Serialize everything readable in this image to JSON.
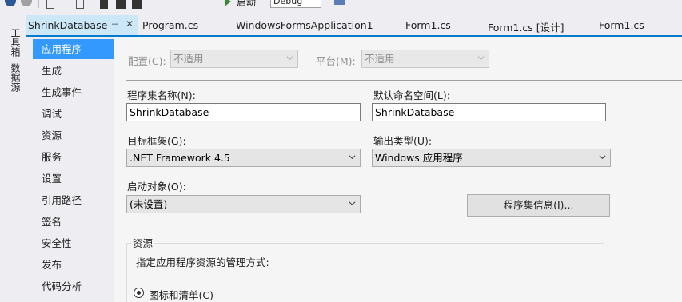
{
  "toolbar": {
    "start_label": "启动",
    "config_value": "Debug"
  },
  "side_tabs": [
    "工具箱",
    "数据源"
  ],
  "document_tabs": {
    "active": "ShrinkDatabase",
    "pin_icon": "pin-icon",
    "close_icon": "close-icon",
    "others": [
      "Program.cs",
      "WindowsFormsApplication1",
      "Form1.cs",
      "Form1.cs [设计]",
      "Form1.cs"
    ]
  },
  "nav": {
    "items": [
      "应用程序",
      "生成",
      "生成事件",
      "调试",
      "资源",
      "服务",
      "设置",
      "引用路径",
      "签名",
      "安全性",
      "发布",
      "代码分析"
    ],
    "active_index": 0
  },
  "config": {
    "config_label": "配置(C):",
    "config_value": "不适用",
    "platform_label": "平台(M):",
    "platform_value": "不适用"
  },
  "assembly": {
    "name_label": "程序集名称(N):",
    "name_value": "ShrinkDatabase",
    "namespace_label": "默认命名空间(L):",
    "namespace_value": "ShrinkDatabase",
    "framework_label": "目标框架(G):",
    "framework_value": ".NET Framework 4.5",
    "output_label": "输出类型(U):",
    "output_value": "Windows 应用程序",
    "startup_label": "启动对象(O):",
    "startup_value": "(未设置)",
    "info_button": "程序集信息(I)..."
  },
  "resources": {
    "group_title": "资源",
    "description": "指定应用程序资源的管理方式:",
    "radio_icon_manifest": "图标和清单(C)"
  },
  "colors": {
    "accent": "#007acc",
    "nav_active": "#3399ff"
  }
}
